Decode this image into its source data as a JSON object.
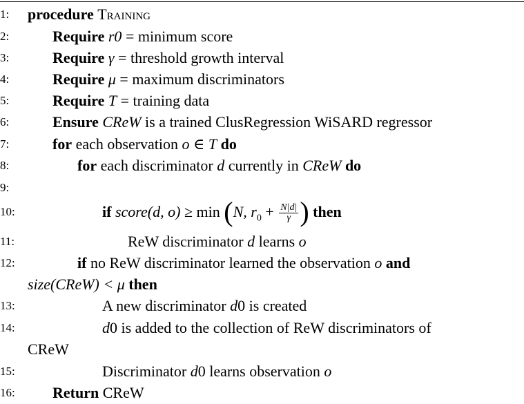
{
  "lines": [
    {
      "n": "1:",
      "kw": "procedure",
      "name": "Training"
    },
    {
      "n": "2:",
      "kw": "Require",
      "var": "r0",
      "rest": " = minimum score"
    },
    {
      "n": "3:",
      "kw": "Require",
      "var": "γ",
      "rest": " = threshold growth interval"
    },
    {
      "n": "4:",
      "kw": "Require",
      "var": "μ",
      "rest": " = maximum discriminators"
    },
    {
      "n": "5:",
      "kw": "Require",
      "var": "T",
      "rest": " = training data"
    },
    {
      "n": "6:",
      "kw": "Ensure",
      "var": "CReW",
      "rest": " is a trained ClusRegression WiSARD regressor"
    },
    {
      "n": "7:",
      "kw": "for",
      "text1": "each observation ",
      "var1": "o",
      "text2": " ∈ ",
      "var2": "T",
      "kw2": "do"
    },
    {
      "n": "8:",
      "kw": "for",
      "text1": "each discriminator ",
      "var1": "d",
      "text2": " currently in ",
      "var2": "CReW",
      "kw2": "do"
    },
    {
      "n": "9:"
    },
    {
      "n": "10:",
      "kw": "if",
      "math_a": "score(d, o)",
      "math_b": " ≥ min ",
      "math_c": "N, r",
      "sub": "0",
      "plus": " + ",
      "frac_top": "N|d|",
      "frac_bot": "γ",
      "kw2": "then"
    },
    {
      "n": "11:",
      "text1": "ReW discriminator ",
      "var1": "d",
      "text2": " learns ",
      "var2": "o"
    },
    {
      "n": "12:",
      "kw": "if",
      "text1": "no ReW discriminator learned the observation ",
      "var1": "o",
      "kw2": "and"
    },
    {
      "n": "",
      "math": "size(CReW) < μ",
      "kw": "then"
    },
    {
      "n": "13:",
      "text1": "A new discriminator ",
      "var1": "d",
      "text2": "0 is created"
    },
    {
      "n": "14:",
      "var1": "d",
      "text1": "0 is added to the collection of ReW discriminators of"
    },
    {
      "n": "",
      "text1": "CReW"
    },
    {
      "n": "15:",
      "text1": "Discriminator ",
      "var1": "d",
      "text2": "0 learns observation ",
      "var2": "o"
    },
    {
      "n": "16:",
      "kw": "Return",
      "text1": " CReW"
    }
  ]
}
